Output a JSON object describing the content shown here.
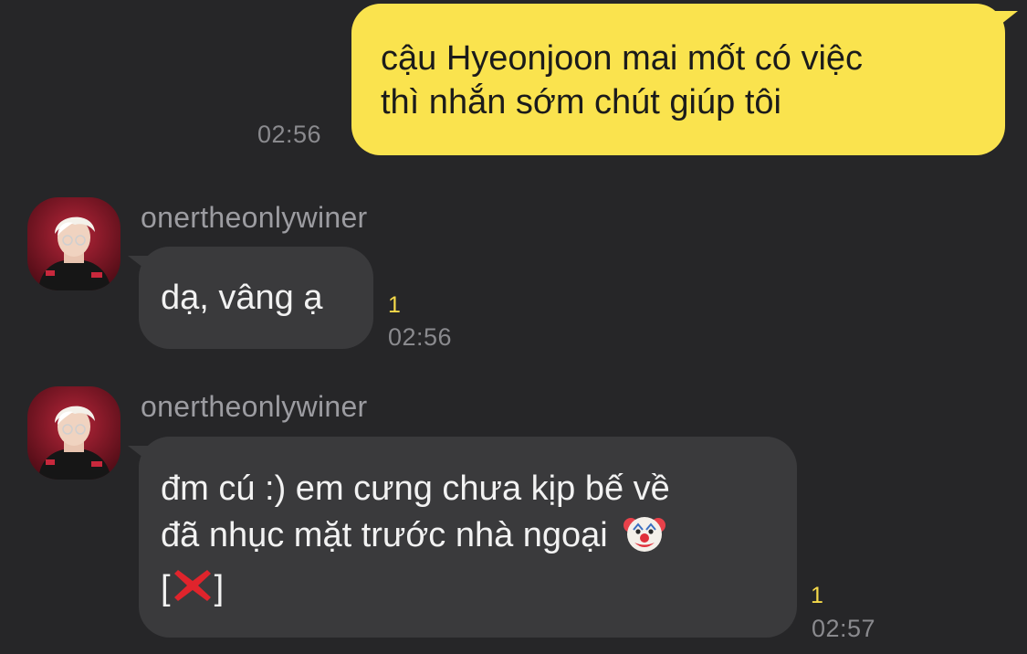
{
  "messages": [
    {
      "direction": "outgoing",
      "text_line1": "cậu Hyeonjoon mai mốt có việc",
      "text_line2": "thì nhắn sớm chút giúp tôi",
      "time": "02:56"
    },
    {
      "direction": "incoming",
      "sender": "onertheonlywiner",
      "text": "dạ, vâng ạ",
      "unread_count": "1",
      "time": "02:56"
    },
    {
      "direction": "incoming",
      "sender": "onertheonlywiner",
      "text_line1": "đm cú :) em cưng chưa kịp bế về",
      "text_line2": "đã nhục mặt trước nhà ngoại",
      "text_line3_open": "[",
      "text_line3_close": "]",
      "emoji_1": "clown-face-emoji",
      "emoji_2": "cross-mark-emoji",
      "unread_count": "1",
      "time": "02:57"
    }
  ],
  "colors": {
    "background": "#262628",
    "outgoing_bubble": "#fae34e",
    "incoming_bubble": "#3a3a3c",
    "unread": "#f5d94a"
  }
}
